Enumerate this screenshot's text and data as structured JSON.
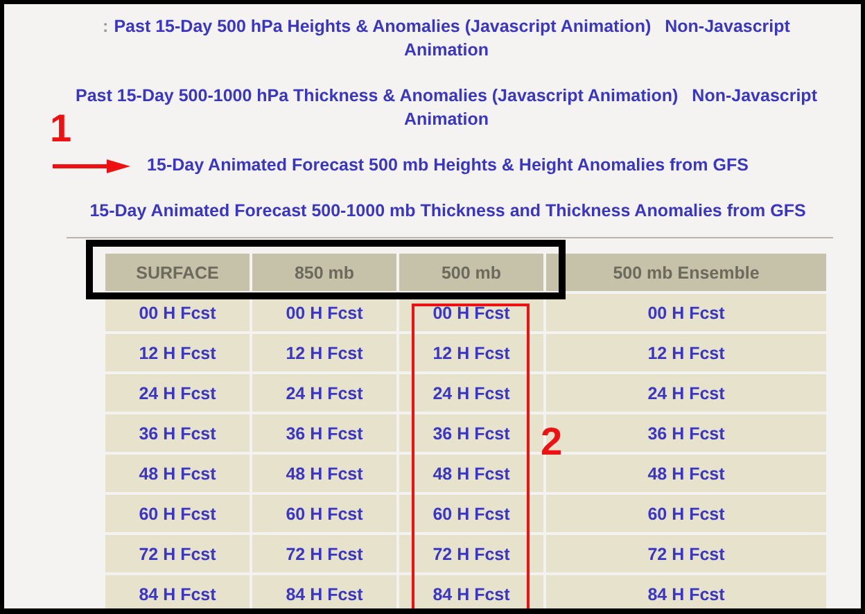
{
  "link_lines": [
    {
      "prefix": ":",
      "links": [
        "Past 15-Day 500 hPa Heights & Anomalies (Javascript Animation)",
        "Non-Javascript Animation"
      ]
    },
    {
      "links": [
        "Past 15-Day 500-1000 hPa Thickness & Anomalies (Javascript Animation)",
        "Non-Javascript Animation"
      ]
    },
    {
      "links": [
        "15-Day Animated Forecast 500 mb Heights & Height Anomalies from GFS"
      ]
    },
    {
      "links": [
        "15-Day Animated Forecast 500-1000 mb Thickness and Thickness Anomalies from GFS"
      ]
    }
  ],
  "table": {
    "columns": [
      "SURFACE",
      "850 mb",
      "500 mb",
      "500 mb Ensemble"
    ],
    "rows": [
      [
        "00 H Fcst",
        "00 H Fcst",
        "00 H Fcst",
        "00 H Fcst"
      ],
      [
        "12 H Fcst",
        "12 H Fcst",
        "12 H Fcst",
        "12 H Fcst"
      ],
      [
        "24 H Fcst",
        "24 H Fcst",
        "24 H Fcst",
        "24 H Fcst"
      ],
      [
        "36 H Fcst",
        "36 H Fcst",
        "36 H Fcst",
        "36 H Fcst"
      ],
      [
        "48 H Fcst",
        "48 H Fcst",
        "48 H Fcst",
        "48 H Fcst"
      ],
      [
        "60 H Fcst",
        "60 H Fcst",
        "60 H Fcst",
        "60 H Fcst"
      ],
      [
        "72 H Fcst",
        "72 H Fcst",
        "72 H Fcst",
        "72 H Fcst"
      ],
      [
        "84 H Fcst",
        "84 H Fcst",
        "84 H Fcst",
        "84 H Fcst"
      ]
    ]
  },
  "annotations": [
    {
      "label": "1"
    },
    {
      "label": "2"
    }
  ]
}
